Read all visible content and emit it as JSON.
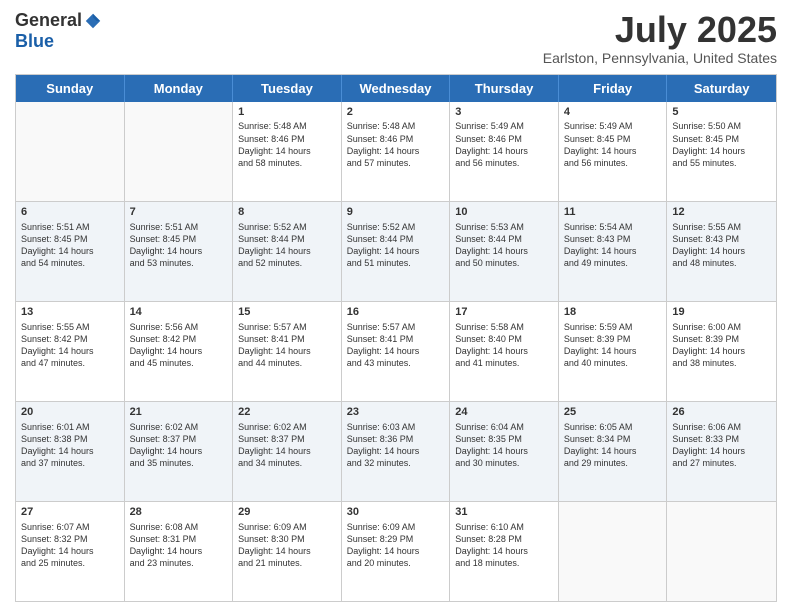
{
  "header": {
    "logo_general": "General",
    "logo_blue": "Blue",
    "title": "July 2025",
    "location": "Earlston, Pennsylvania, United States"
  },
  "weekdays": [
    "Sunday",
    "Monday",
    "Tuesday",
    "Wednesday",
    "Thursday",
    "Friday",
    "Saturday"
  ],
  "rows": [
    [
      {
        "day": "",
        "detail": ""
      },
      {
        "day": "",
        "detail": ""
      },
      {
        "day": "1",
        "detail": "Sunrise: 5:48 AM\nSunset: 8:46 PM\nDaylight: 14 hours\nand 58 minutes."
      },
      {
        "day": "2",
        "detail": "Sunrise: 5:48 AM\nSunset: 8:46 PM\nDaylight: 14 hours\nand 57 minutes."
      },
      {
        "day": "3",
        "detail": "Sunrise: 5:49 AM\nSunset: 8:46 PM\nDaylight: 14 hours\nand 56 minutes."
      },
      {
        "day": "4",
        "detail": "Sunrise: 5:49 AM\nSunset: 8:45 PM\nDaylight: 14 hours\nand 56 minutes."
      },
      {
        "day": "5",
        "detail": "Sunrise: 5:50 AM\nSunset: 8:45 PM\nDaylight: 14 hours\nand 55 minutes."
      }
    ],
    [
      {
        "day": "6",
        "detail": "Sunrise: 5:51 AM\nSunset: 8:45 PM\nDaylight: 14 hours\nand 54 minutes."
      },
      {
        "day": "7",
        "detail": "Sunrise: 5:51 AM\nSunset: 8:45 PM\nDaylight: 14 hours\nand 53 minutes."
      },
      {
        "day": "8",
        "detail": "Sunrise: 5:52 AM\nSunset: 8:44 PM\nDaylight: 14 hours\nand 52 minutes."
      },
      {
        "day": "9",
        "detail": "Sunrise: 5:52 AM\nSunset: 8:44 PM\nDaylight: 14 hours\nand 51 minutes."
      },
      {
        "day": "10",
        "detail": "Sunrise: 5:53 AM\nSunset: 8:44 PM\nDaylight: 14 hours\nand 50 minutes."
      },
      {
        "day": "11",
        "detail": "Sunrise: 5:54 AM\nSunset: 8:43 PM\nDaylight: 14 hours\nand 49 minutes."
      },
      {
        "day": "12",
        "detail": "Sunrise: 5:55 AM\nSunset: 8:43 PM\nDaylight: 14 hours\nand 48 minutes."
      }
    ],
    [
      {
        "day": "13",
        "detail": "Sunrise: 5:55 AM\nSunset: 8:42 PM\nDaylight: 14 hours\nand 47 minutes."
      },
      {
        "day": "14",
        "detail": "Sunrise: 5:56 AM\nSunset: 8:42 PM\nDaylight: 14 hours\nand 45 minutes."
      },
      {
        "day": "15",
        "detail": "Sunrise: 5:57 AM\nSunset: 8:41 PM\nDaylight: 14 hours\nand 44 minutes."
      },
      {
        "day": "16",
        "detail": "Sunrise: 5:57 AM\nSunset: 8:41 PM\nDaylight: 14 hours\nand 43 minutes."
      },
      {
        "day": "17",
        "detail": "Sunrise: 5:58 AM\nSunset: 8:40 PM\nDaylight: 14 hours\nand 41 minutes."
      },
      {
        "day": "18",
        "detail": "Sunrise: 5:59 AM\nSunset: 8:39 PM\nDaylight: 14 hours\nand 40 minutes."
      },
      {
        "day": "19",
        "detail": "Sunrise: 6:00 AM\nSunset: 8:39 PM\nDaylight: 14 hours\nand 38 minutes."
      }
    ],
    [
      {
        "day": "20",
        "detail": "Sunrise: 6:01 AM\nSunset: 8:38 PM\nDaylight: 14 hours\nand 37 minutes."
      },
      {
        "day": "21",
        "detail": "Sunrise: 6:02 AM\nSunset: 8:37 PM\nDaylight: 14 hours\nand 35 minutes."
      },
      {
        "day": "22",
        "detail": "Sunrise: 6:02 AM\nSunset: 8:37 PM\nDaylight: 14 hours\nand 34 minutes."
      },
      {
        "day": "23",
        "detail": "Sunrise: 6:03 AM\nSunset: 8:36 PM\nDaylight: 14 hours\nand 32 minutes."
      },
      {
        "day": "24",
        "detail": "Sunrise: 6:04 AM\nSunset: 8:35 PM\nDaylight: 14 hours\nand 30 minutes."
      },
      {
        "day": "25",
        "detail": "Sunrise: 6:05 AM\nSunset: 8:34 PM\nDaylight: 14 hours\nand 29 minutes."
      },
      {
        "day": "26",
        "detail": "Sunrise: 6:06 AM\nSunset: 8:33 PM\nDaylight: 14 hours\nand 27 minutes."
      }
    ],
    [
      {
        "day": "27",
        "detail": "Sunrise: 6:07 AM\nSunset: 8:32 PM\nDaylight: 14 hours\nand 25 minutes."
      },
      {
        "day": "28",
        "detail": "Sunrise: 6:08 AM\nSunset: 8:31 PM\nDaylight: 14 hours\nand 23 minutes."
      },
      {
        "day": "29",
        "detail": "Sunrise: 6:09 AM\nSunset: 8:30 PM\nDaylight: 14 hours\nand 21 minutes."
      },
      {
        "day": "30",
        "detail": "Sunrise: 6:09 AM\nSunset: 8:29 PM\nDaylight: 14 hours\nand 20 minutes."
      },
      {
        "day": "31",
        "detail": "Sunrise: 6:10 AM\nSunset: 8:28 PM\nDaylight: 14 hours\nand 18 minutes."
      },
      {
        "day": "",
        "detail": ""
      },
      {
        "day": "",
        "detail": ""
      }
    ]
  ]
}
